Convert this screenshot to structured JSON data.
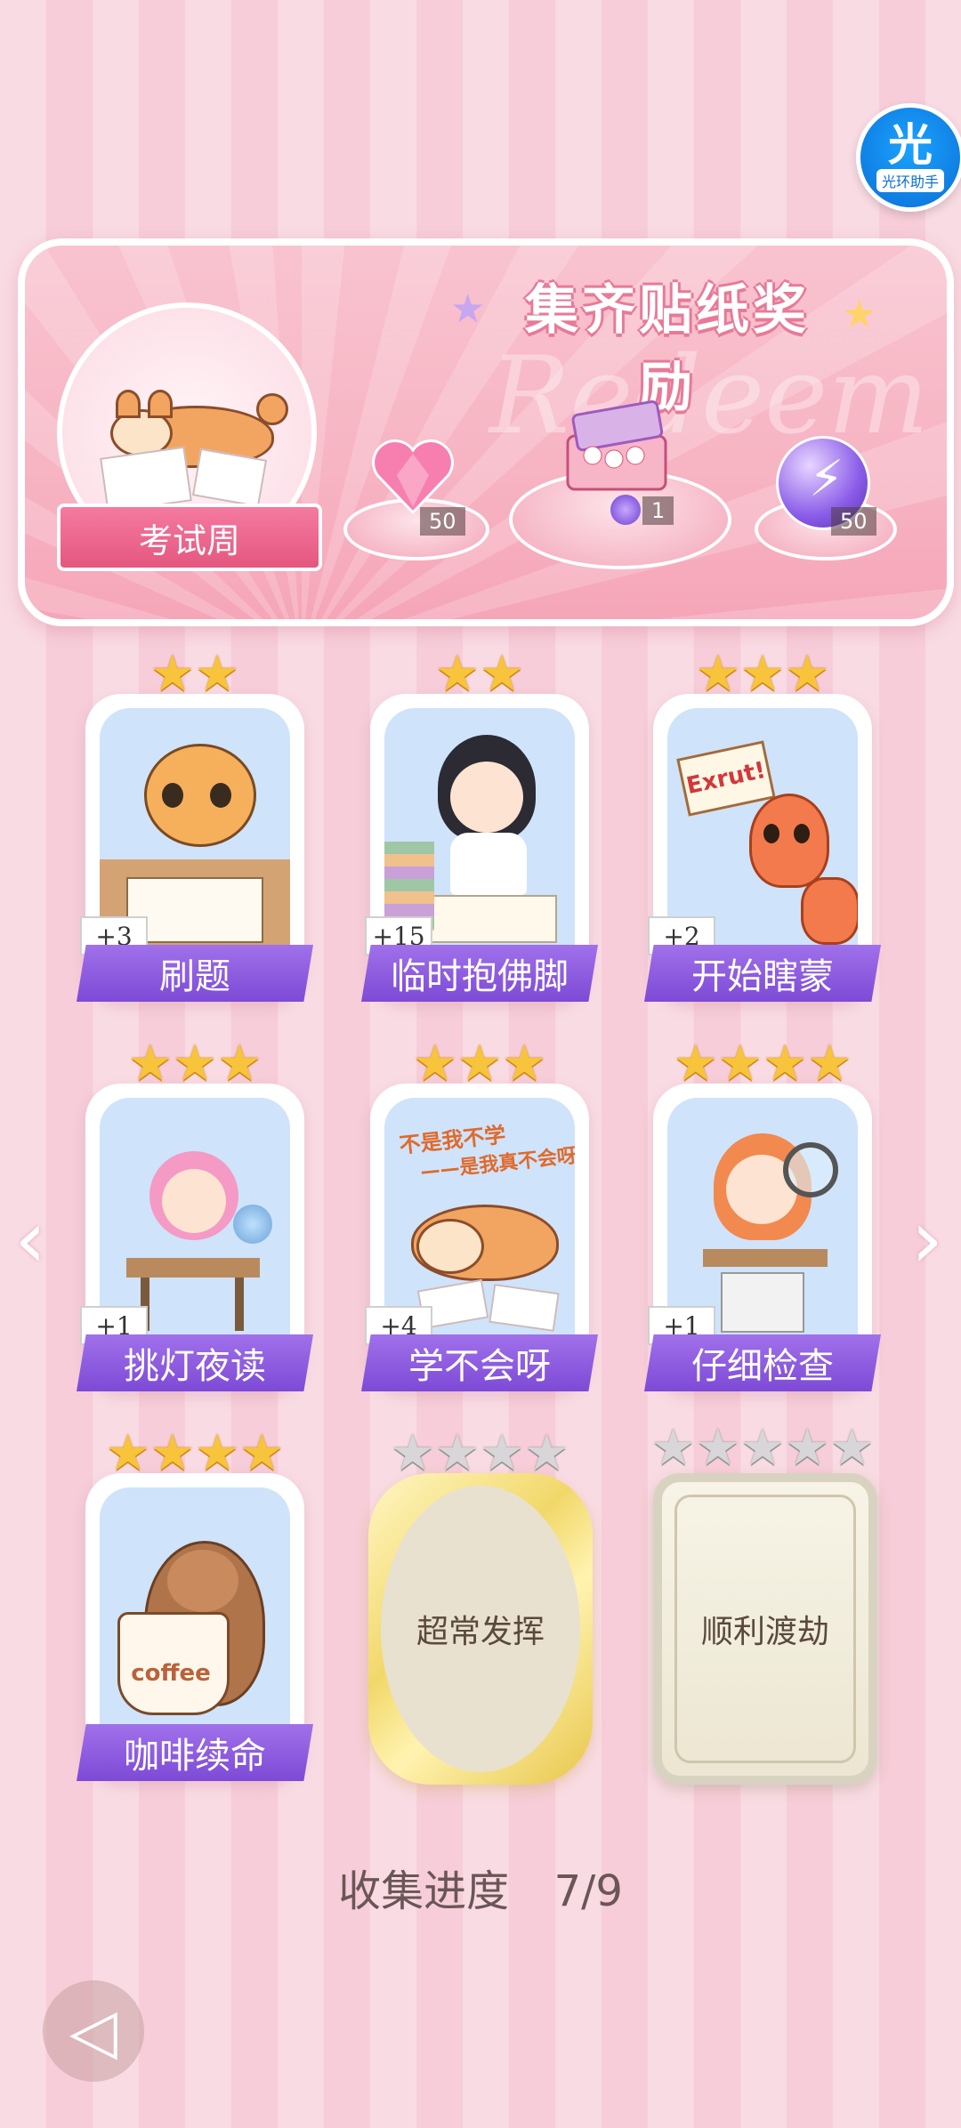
{
  "assistant": {
    "glyph": "光",
    "caption": "光环助手"
  },
  "banner": {
    "title": "集齐贴纸奖励",
    "watermark": "Redeem",
    "theme_label": "考试周",
    "rewards": [
      {
        "icon": "pink-heart-gem-icon",
        "count": "50"
      },
      {
        "icon": "gift-box-icon",
        "count": "1"
      },
      {
        "icon": "purple-energy-orb-icon",
        "count": "50"
      }
    ]
  },
  "cards": [
    {
      "name": "刷题",
      "stars": 2,
      "bonus": "+3",
      "unlocked": true,
      "art": "cat-studying"
    },
    {
      "name": "临时抱佛脚",
      "stars": 2,
      "bonus": "+15",
      "unlocked": true,
      "art": "girl-praying"
    },
    {
      "name": "开始瞎蒙",
      "stars": 3,
      "bonus": "+2",
      "unlocked": true,
      "art": "shrimp-sign",
      "sign_text": "Exrut!"
    },
    {
      "name": "挑灯夜读",
      "stars": 3,
      "bonus": "+1",
      "unlocked": true,
      "art": "girl-desk"
    },
    {
      "name": "学不会呀",
      "stars": 3,
      "bonus": "+4",
      "unlocked": true,
      "art": "dog-lying",
      "art_text_1": "不是我不学",
      "art_text_2": "——是我真不会呀"
    },
    {
      "name": "仔细检查",
      "stars": 4,
      "bonus": "+1",
      "unlocked": true,
      "art": "girl-magnifier"
    },
    {
      "name": "咖啡续命",
      "stars": 4,
      "bonus": "",
      "unlocked": true,
      "art": "bear-coffee",
      "art_text_1": "coffee"
    },
    {
      "name": "超常发挥",
      "stars": 4,
      "bonus": "",
      "unlocked": false,
      "frame": "gold"
    },
    {
      "name": "顺利渡劫",
      "stars": 5,
      "bonus": "",
      "unlocked": false,
      "frame": "silver"
    }
  ],
  "progress": {
    "label": "收集进度",
    "value": "7/9",
    "collected": 7,
    "total": 9
  },
  "colors": {
    "label_purple": "#8a58de",
    "star_gold": "#f7c43c",
    "banner_pink": "#f7b4c3"
  }
}
